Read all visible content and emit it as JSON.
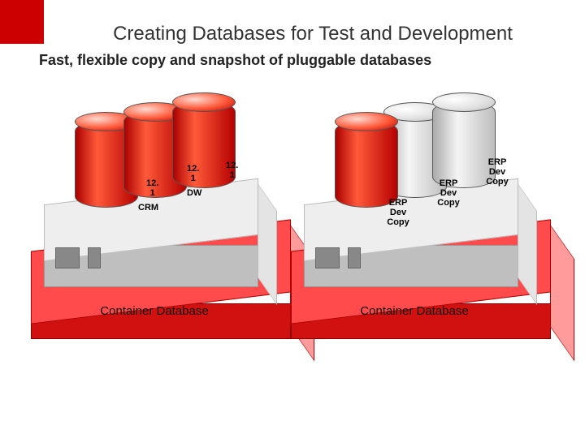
{
  "title": "Creating Databases for Test and Development",
  "subtitle": "Fast, flexible copy and snapshot of pluggable databases",
  "left": {
    "caption": "Container Database",
    "cylinders": [
      {
        "label": "CRM",
        "sub": "12. 1"
      },
      {
        "label": "DW",
        "sub": "12. 1"
      },
      {
        "label": "",
        "sub": "12. 1"
      }
    ]
  },
  "right": {
    "caption": "Container Database",
    "cylinders": [
      {
        "label": "ERP Dev Copy"
      },
      {
        "label": "ERP Dev Copy"
      },
      {
        "label": "ERP Dev Copy"
      }
    ]
  }
}
